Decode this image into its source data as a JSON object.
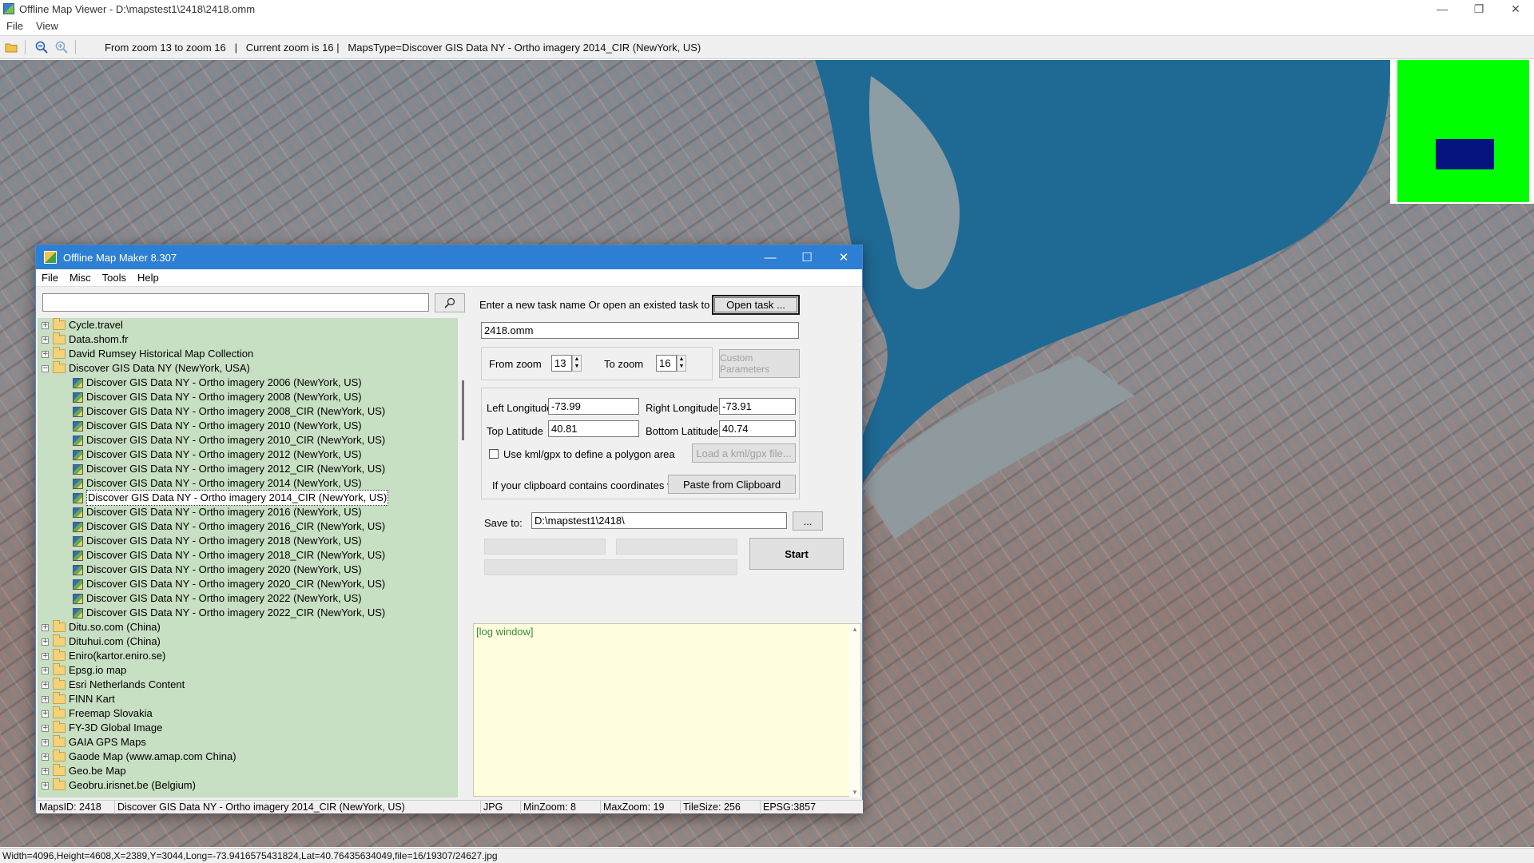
{
  "window": {
    "title": "Offline Map Viewer - D:\\mapstest1\\2418\\2418.omm",
    "controls": {
      "minimize": "—",
      "maximize": "❐",
      "close": "✕"
    }
  },
  "menubar": [
    "File",
    "View"
  ],
  "toolbar": {
    "status": "From zoom 13 to zoom 16   |   Current zoom is 16 |   MapsType=Discover GIS Data NY - Ortho imagery 2014_CIR (NewYork, US)"
  },
  "bottom_status": "Width=4096,Height=4608,X=2389,Y=3044,Long=-73.9416575431824,Lat=40.76435634049,file=16/19307/24627.jpg",
  "overview_colors": {
    "background": "#00ff00",
    "viewport": "#041380"
  },
  "dialog": {
    "title": "Offline Map Maker 8.307",
    "controls": {
      "minimize": "—",
      "maximize": "☐",
      "close": "✕"
    },
    "menu": [
      "File",
      "Misc",
      "Tools",
      "Help"
    ],
    "tree": [
      {
        "label": "Cycle.travel",
        "level": 0,
        "type": "folder",
        "state": "+"
      },
      {
        "label": "Data.shom.fr",
        "level": 0,
        "type": "folder",
        "state": "+"
      },
      {
        "label": "David Rumsey Historical Map Collection",
        "level": 0,
        "type": "folder",
        "state": "+"
      },
      {
        "label": "Discover GIS Data NY (NewYork, USA)",
        "level": 0,
        "type": "folder",
        "state": "−"
      },
      {
        "label": "Discover GIS Data NY - Ortho imagery 2006 (NewYork, US)",
        "level": 1,
        "type": "map"
      },
      {
        "label": "Discover GIS Data NY - Ortho imagery 2008 (NewYork, US)",
        "level": 1,
        "type": "map"
      },
      {
        "label": "Discover GIS Data NY - Ortho imagery 2008_CIR (NewYork, US)",
        "level": 1,
        "type": "map"
      },
      {
        "label": "Discover GIS Data NY - Ortho imagery 2010 (NewYork, US)",
        "level": 1,
        "type": "map"
      },
      {
        "label": "Discover GIS Data NY - Ortho imagery 2010_CIR (NewYork, US)",
        "level": 1,
        "type": "map"
      },
      {
        "label": "Discover GIS Data NY - Ortho imagery 2012 (NewYork, US)",
        "level": 1,
        "type": "map"
      },
      {
        "label": "Discover GIS Data NY - Ortho imagery 2012_CIR (NewYork, US)",
        "level": 1,
        "type": "map"
      },
      {
        "label": "Discover GIS Data NY - Ortho imagery 2014 (NewYork, US)",
        "level": 1,
        "type": "map"
      },
      {
        "label": "Discover GIS Data NY - Ortho imagery 2014_CIR (NewYork, US)",
        "level": 1,
        "type": "map",
        "selected": true
      },
      {
        "label": "Discover GIS Data NY - Ortho imagery 2016 (NewYork, US)",
        "level": 1,
        "type": "map"
      },
      {
        "label": "Discover GIS Data NY - Ortho imagery 2016_CIR (NewYork, US)",
        "level": 1,
        "type": "map"
      },
      {
        "label": "Discover GIS Data NY - Ortho imagery 2018 (NewYork, US)",
        "level": 1,
        "type": "map"
      },
      {
        "label": "Discover GIS Data NY - Ortho imagery 2018_CIR (NewYork, US)",
        "level": 1,
        "type": "map"
      },
      {
        "label": "Discover GIS Data NY - Ortho imagery 2020 (NewYork, US)",
        "level": 1,
        "type": "map"
      },
      {
        "label": "Discover GIS Data NY - Ortho imagery 2020_CIR (NewYork, US)",
        "level": 1,
        "type": "map"
      },
      {
        "label": "Discover GIS Data NY - Ortho imagery 2022 (NewYork, US)",
        "level": 1,
        "type": "map"
      },
      {
        "label": "Discover GIS Data NY - Ortho imagery 2022_CIR (NewYork, US)",
        "level": 1,
        "type": "map"
      },
      {
        "label": "Ditu.so.com (China)",
        "level": 0,
        "type": "folder",
        "state": "+"
      },
      {
        "label": "Dituhui.com (China)",
        "level": 0,
        "type": "folder",
        "state": "+"
      },
      {
        "label": "Eniro(kartor.eniro.se)",
        "level": 0,
        "type": "folder",
        "state": "+"
      },
      {
        "label": "Epsg.io map",
        "level": 0,
        "type": "folder",
        "state": "+"
      },
      {
        "label": "Esri Netherlands Content",
        "level": 0,
        "type": "folder",
        "state": "+"
      },
      {
        "label": "FINN Kart",
        "level": 0,
        "type": "folder",
        "state": "+"
      },
      {
        "label": "Freemap Slovakia",
        "level": 0,
        "type": "folder",
        "state": "+"
      },
      {
        "label": "FY-3D Global Image",
        "level": 0,
        "type": "folder",
        "state": "+"
      },
      {
        "label": "GAIA GPS Maps",
        "level": 0,
        "type": "folder",
        "state": "+"
      },
      {
        "label": "Gaode Map (www.amap.com China)",
        "level": 0,
        "type": "folder",
        "state": "+"
      },
      {
        "label": "Geo.be Map",
        "level": 0,
        "type": "folder",
        "state": "+"
      },
      {
        "label": "Geobru.irisnet.be (Belgium)",
        "level": 0,
        "type": "folder",
        "state": "+"
      }
    ],
    "task": {
      "prompt": "Enter a new task name Or open an existed task to continue:",
      "open_button": "Open task ...",
      "name": "2418.omm"
    },
    "zoom": {
      "from_label": "From zoom",
      "from_value": "13",
      "to_label": "To zoom",
      "to_value": "16",
      "custom_button": "Custom Parameters"
    },
    "coords": {
      "left_label": "Left Longitude",
      "left_value": "-73.99",
      "right_label": "Right Longitude",
      "right_value": "-73.91",
      "top_label": "Top Latitude",
      "top_value": "40.81",
      "bottom_label": "Bottom Latitude",
      "bottom_value": "40.74",
      "kml_label": "Use kml/gpx to define a polygon area",
      "kml_button": "Load a kml/gpx file...",
      "clipboard_label": "If your clipboard contains coordinates values:",
      "clipboard_button": "Paste from Clipboard"
    },
    "save": {
      "label": "Save to:",
      "value": "D:\\mapstest1\\2418\\",
      "browse": "..."
    },
    "start_button": "Start",
    "log_text": "[log window]",
    "status": {
      "maps_id": "MapsID: 2418",
      "map_name": "Discover GIS Data NY - Ortho imagery 2014_CIR (NewYork, US)",
      "format": "JPG",
      "min_zoom": "MinZoom: 8",
      "max_zoom": "MaxZoom: 19",
      "tile_size": "TileSize: 256",
      "epsg": "EPSG:3857"
    }
  }
}
